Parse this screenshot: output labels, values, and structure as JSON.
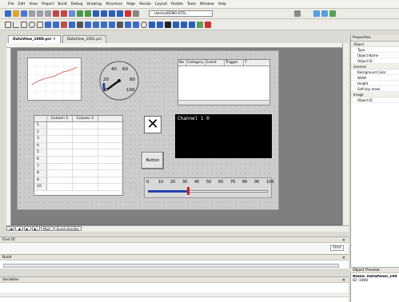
{
  "menu": [
    "File",
    "Edit",
    "View",
    "Project",
    "Build",
    "Debug",
    "Drawing",
    "Structure",
    "Align",
    "Resize",
    "Layout",
    "Rotate",
    "Tools",
    "Window",
    "Help"
  ],
  "toolbar": {
    "path_combo": "…\\demos\\DEMO-DTS\\…"
  },
  "tabs": [
    {
      "label": "DataView_1000.pcl"
    },
    {
      "label": "DataView_1001.pcl"
    }
  ],
  "table_widget": {
    "headers": [
      "Column 1",
      "Column 2"
    ],
    "rows": [
      "1",
      "2",
      "3",
      "4",
      "5",
      "6",
      "7",
      "8",
      "9",
      "10"
    ]
  },
  "event_table": {
    "headers": [
      "No",
      "Category",
      "Event",
      "Trigger",
      "T"
    ]
  },
  "gauge": {
    "labels": [
      "40",
      "60",
      "20",
      "80",
      "0",
      "100"
    ],
    "value": 5
  },
  "channel": {
    "label": "Channel 1  0"
  },
  "button_widget": {
    "label": "Button"
  },
  "slider": {
    "ticks": [
      "0",
      "10",
      "20",
      "30",
      "40",
      "50",
      "60",
      "70",
      "80",
      "90",
      "100"
    ],
    "value": 33
  },
  "sheet_tabs": [
    "Main",
    "Event Handler"
  ],
  "panels": {
    "find": "Find Of",
    "find_button": "Find",
    "build": "Build",
    "variables": "Variables",
    "object_preview": "Object Preview",
    "preview_name": "Name: DataPanel_1001",
    "preview_id": "ID:    1000"
  },
  "properties": {
    "title": "Properties",
    "sections": [
      {
        "name": "Object",
        "items": [
          "Type",
          "Object Name",
          "Object ID"
        ]
      },
      {
        "name": "General",
        "items": [
          "Background Color",
          "Width",
          "Height",
          "Soft key mask"
        ]
      },
      {
        "name": "Image",
        "items": [
          "Object ID"
        ]
      }
    ]
  },
  "colors": {
    "accent": "#cc2222",
    "slider_blue": "#2244aa",
    "trend_line": "#e07070"
  },
  "chart_data": {
    "type": "line",
    "x": [
      0,
      1,
      2,
      3,
      4,
      5,
      6,
      7,
      8,
      9,
      10
    ],
    "values": [
      1,
      1.3,
      1.5,
      1.7,
      1.8,
      1.9,
      2.2,
      2.4,
      2.5,
      2.7,
      2.9
    ]
  }
}
